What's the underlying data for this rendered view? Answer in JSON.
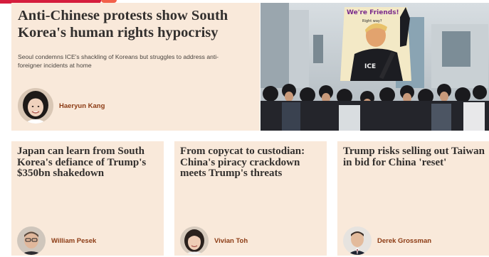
{
  "lead": {
    "title": "Anti-Chinese protests show South Korea's human rights hypocrisy",
    "standfirst": "Seoul condemns ICE's shackling of Koreans but struggles to address anti-foreigner incidents at home",
    "author": "Haeryun Kang",
    "image": {
      "sign_text_line1": "We're Friends!",
      "sign_text_line2": "Right way?",
      "vest_text": "ICE"
    }
  },
  "cards": [
    {
      "title": "Japan can learn from South Korea's defiance of Trump's $350bn shakedown",
      "author": "William Pesek"
    },
    {
      "title": "From copycat to custodian: China's piracy crackdown meets Trump's threats",
      "author": "Vivian Toh"
    },
    {
      "title": "Trump risks selling out Taiwan in bid for China 'reset'",
      "author": "Derek Grossman"
    }
  ],
  "colors": {
    "card_background": "#f9e9da",
    "author_name": "#8c3b14",
    "headline": "#33302e",
    "brand_red": "#d51d3d"
  }
}
